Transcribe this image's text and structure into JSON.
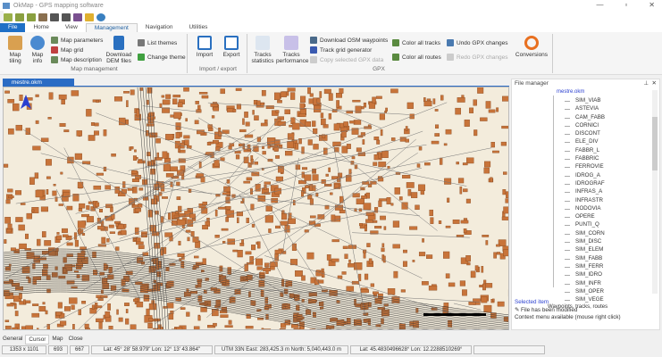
{
  "window": {
    "title": "OkMap - GPS mapping software"
  },
  "ribbon_tabs": [
    "File",
    "Home",
    "View",
    "Management",
    "Navigation",
    "Utilities"
  ],
  "active_tab": "Management",
  "groups": {
    "map_management": {
      "label": "Map management",
      "map_tiling": "Map tiling",
      "map_info": "Map info",
      "map_parameters": "Map parameters",
      "map_grid": "Map grid",
      "map_description": "Map description",
      "download_dem": "Download DEM files",
      "list_themes": "List themes",
      "change_theme": "Change theme"
    },
    "import_export": {
      "label": "Import / export",
      "import": "Import",
      "export": "Export"
    },
    "gpx": {
      "label": "GPX",
      "tracks_statistics": "Tracks statistics",
      "tracks_performance": "Tracks performance",
      "download_osm": "Download OSM waypoints",
      "track_grid": "Track grid generator",
      "copy_gpx": "Copy selected GPX data",
      "color_tracks": "Color all tracks",
      "color_routes": "Color all routes",
      "undo": "Undo GPX changes",
      "redo": "Redo GPX changes"
    },
    "conversions": {
      "label": "Conversions"
    }
  },
  "document_tab": "mestre.okm",
  "file_manager": {
    "title": "File manager",
    "root": "mestre.okm",
    "items": [
      "SIM_VIAB",
      "ASTEVIA",
      "CAM_FABB",
      "CORNICI",
      "DISCONT",
      "ELE_DIV",
      "FABBR_L",
      "FABBRIC",
      "FERROVIE",
      "IDROG_A",
      "IDROGRAF",
      "INFRAS_A",
      "INFRASTR",
      "NODOVIA",
      "OPERE",
      "PUNTI_Q",
      "SIM_CORN",
      "SIM_DISC",
      "SIM_ELEM",
      "SIM_FABB",
      "SIM_FERR",
      "SIM_IDRO",
      "SIM_INFR",
      "SIM_OPER",
      "SIM_VEGE"
    ],
    "next_node": "Waypoints, tracks, routes",
    "selected_label": "Selected item",
    "modified": "File has been modified",
    "context": "Context menu available (mouse right click)"
  },
  "bottom_tabs": [
    "General",
    "Cursor",
    "Map",
    "Close"
  ],
  "active_bottom_tab": "Cursor",
  "status": [
    "1353 x 1101",
    "693",
    "667",
    "Lat: 45° 28' 58.979\"  Lon: 12° 13' 43.864\"",
    "UTM 33N  East: 283,425.3 m  North: 5,040,443.0 m",
    "Lat: 45.4830496628°  Lon: 12.2288510269°",
    ""
  ],
  "colors": {
    "accent": "#1e6fc6",
    "buildings": "#c8743a",
    "map_bg": "#f3ecdc"
  }
}
